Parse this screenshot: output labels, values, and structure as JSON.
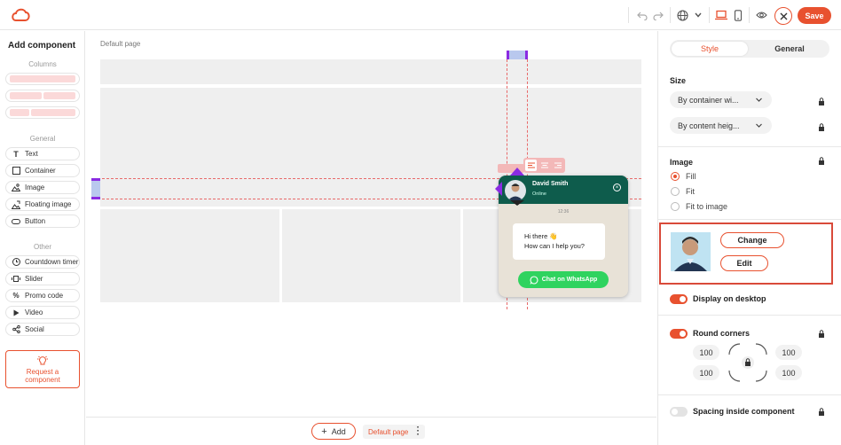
{
  "topbar": {
    "save_label": "Save",
    "icons": [
      "logo-icon",
      "undo-icon",
      "redo-icon",
      "globe-icon",
      "chevron-down-icon",
      "desktop-icon",
      "mobile-icon",
      "eye-icon",
      "close-icon"
    ]
  },
  "left_panel": {
    "title": "Add component",
    "columns_label": "Columns",
    "general_label": "General",
    "general_items": [
      "Text",
      "Container",
      "Image",
      "Floating image",
      "Button"
    ],
    "other_label": "Other",
    "other_items": [
      "Countdown timer",
      "Slider",
      "Promo code",
      "Video",
      "Social"
    ],
    "request_line1": "Request a",
    "request_line2": "component"
  },
  "canvas": {
    "page_label": "Default page",
    "whatsapp": {
      "name": "David Smith",
      "status": "Online",
      "time": "12:36",
      "message_line1": "Hi there 👋",
      "message_line2": "How can I help you?",
      "button_label": "Chat on WhatsApp"
    }
  },
  "bottombar": {
    "add_label": "Add",
    "page_label": "Default page"
  },
  "right_panel": {
    "tabs": [
      "Style",
      "General"
    ],
    "size_title": "Size",
    "size_width": "By container wi...",
    "size_height": "By content heig...",
    "image_title": "Image",
    "image_options": [
      "Fill",
      "Fit",
      "Fit to image"
    ],
    "image_selected": "Fill",
    "change_label": "Change",
    "edit_label": "Edit",
    "display_desktop": "Display on desktop",
    "round_corners": "Round corners",
    "corners": [
      "100",
      "100",
      "100",
      "100"
    ],
    "spacing": "Spacing inside component"
  },
  "colors": {
    "accent": "#e8512f",
    "whatsapp_header": "#0e5c4c",
    "whatsapp_button": "#2fd35f"
  }
}
